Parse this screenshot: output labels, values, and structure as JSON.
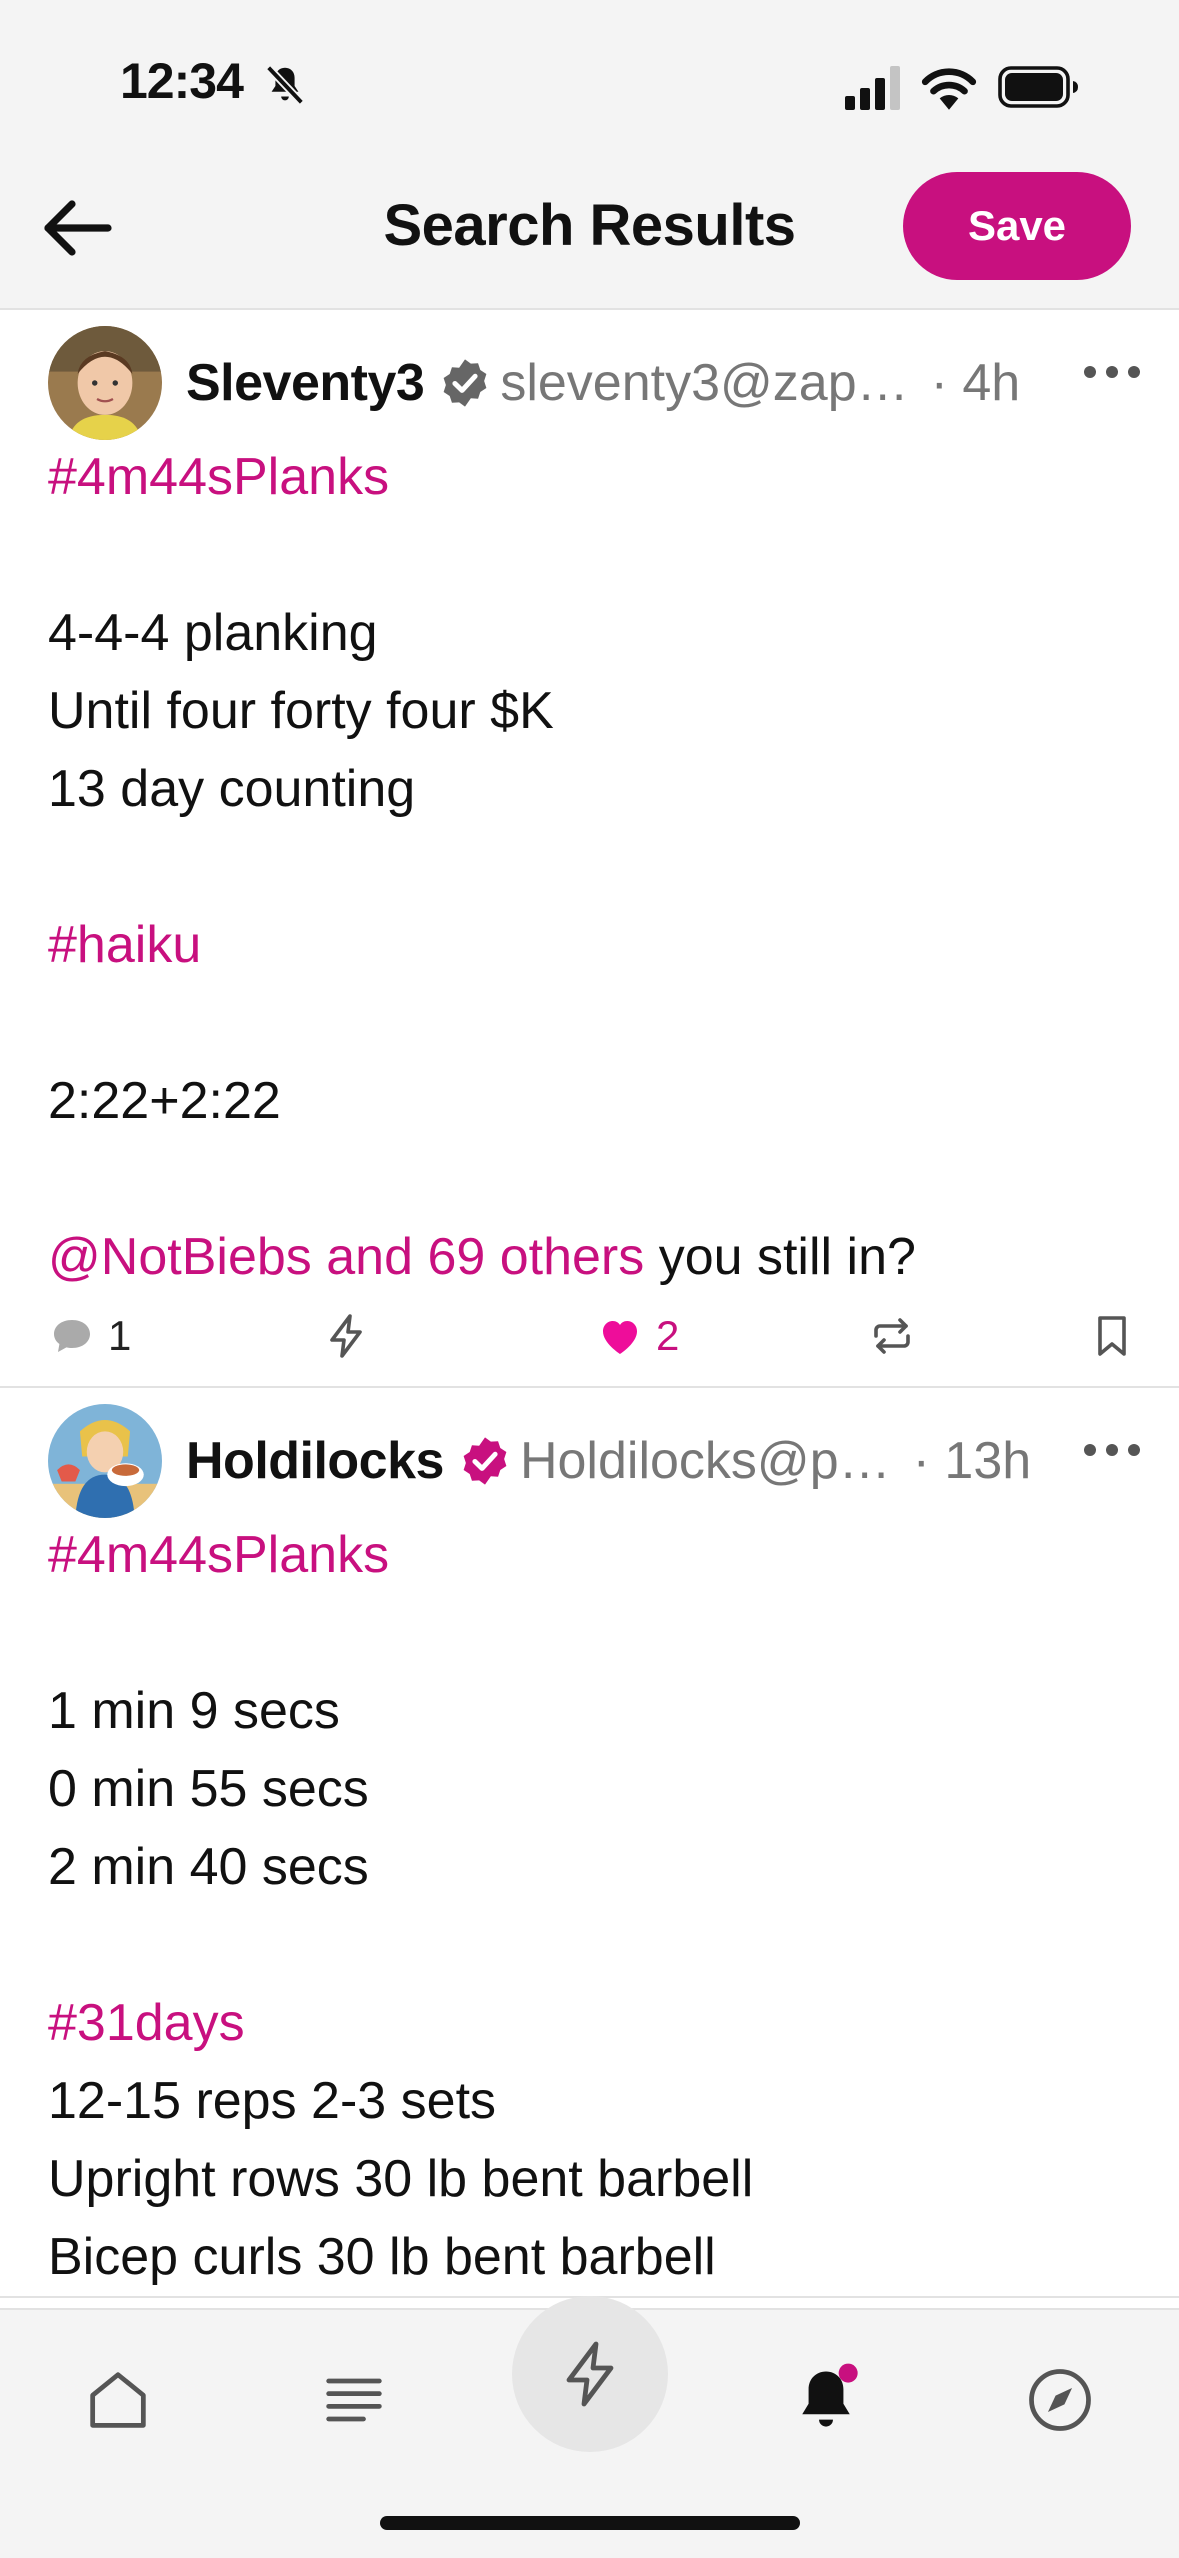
{
  "status_bar": {
    "time": "12:34"
  },
  "nav": {
    "title": "Search Results",
    "save_label": "Save"
  },
  "colors": {
    "accent": "#c8107f",
    "like": "#ee0d9a",
    "text": "#111111",
    "muted": "#777777"
  },
  "posts": [
    {
      "author": "Sleventy3",
      "handle": "sleventy3@zap…",
      "time": "· 4h",
      "verified_color": "#666666",
      "content": {
        "hashtag1": "#4m44sPlanks",
        "l1": "4-4-4 planking",
        "l2": "Until four forty four $K",
        "l3": "13 day counting",
        "hashtag2": "#haiku",
        "l4": "2:22+2:22",
        "mention": "@NotBiebs and 69 others",
        "mention_tail": " you still in?"
      },
      "actions": {
        "replies": "1",
        "likes": "2",
        "liked": true
      }
    },
    {
      "author": "Holdilocks",
      "handle": "Holdilocks@p…",
      "time": "· 13h",
      "verified_color": "#c8107f",
      "content": {
        "hashtag1": "#4m44sPlanks",
        "l1": "1 min 9 secs",
        "l2": "0 min 55 secs",
        "l3": "2 min 40 secs",
        "hashtag2": "#31days",
        "l4": "12-15 reps 2-3 sets",
        "l5": "Upright rows 30 lb bent barbell",
        "l6": "Bicep curls 30 lb bent barbell"
      }
    }
  ],
  "tab_bar": {
    "items": [
      "home-icon",
      "feed-icon",
      "zap-icon",
      "notifications-icon",
      "explore-icon"
    ],
    "notification_dot": true
  }
}
